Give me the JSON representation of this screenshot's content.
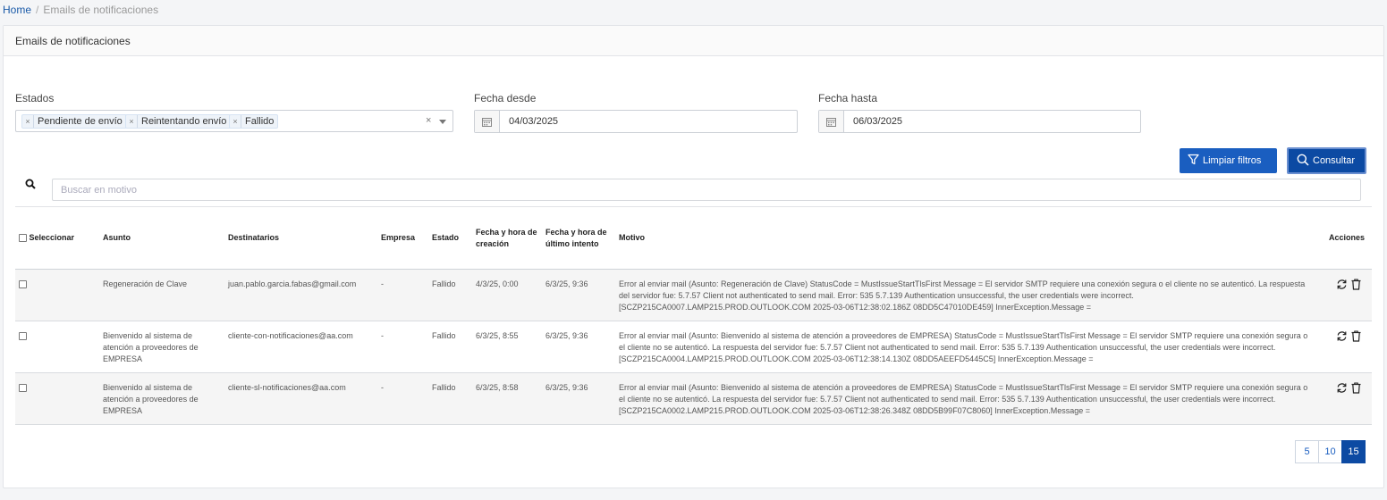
{
  "breadcrumb": {
    "home": "Home",
    "separator": "/",
    "current": "Emails de notificaciones"
  },
  "card": {
    "title": "Emails de notificaciones"
  },
  "filters": {
    "estados": {
      "label": "Estados",
      "tags": [
        "Pendiente de envío",
        "Reintentando envío",
        "Fallido"
      ],
      "remove": "×",
      "clear": "×"
    },
    "fecha_desde": {
      "label": "Fecha desde",
      "value": "04/03/2025",
      "icon": "calendar-icon"
    },
    "fecha_hasta": {
      "label": "Fecha hasta",
      "value": "06/03/2025",
      "icon": "calendar-icon"
    }
  },
  "buttons": {
    "clear": "Limpiar filtros",
    "search": "Consultar"
  },
  "search": {
    "placeholder": "Buscar en motivo"
  },
  "table": {
    "headers": {
      "select": "Seleccionar",
      "asunto": "Asunto",
      "destinatarios": "Destinatarios",
      "empresa": "Empresa",
      "estado": "Estado",
      "fecha_creacion": "Fecha y hora de creación",
      "fecha_ultimo": "Fecha y hora de último intento",
      "motivo": "Motivo",
      "acciones": "Acciones"
    },
    "rows": [
      {
        "asunto": "Regeneración de Clave",
        "destinatarios": "juan.pablo.garcia.fabas@gmail.com",
        "empresa": "-",
        "estado": "Fallido",
        "fecha_creacion": "4/3/25, 0:00",
        "fecha_ultimo": "6/3/25, 9:36",
        "motivo": "Error al enviar mail (Asunto: Regeneración de Clave) StatusCode = MustIssueStartTlsFirst Message = El servidor SMTP requiere una conexión segura o el cliente no se autenticó. La respuesta del servidor fue: 5.7.57 Client not authenticated to send mail. Error: 535 5.7.139 Authentication unsuccessful, the user credentials were incorrect. [SCZP215CA0007.LAMP215.PROD.OUTLOOK.COM 2025-03-06T12:38:02.186Z 08DD5C47010DE459] InnerException.Message ="
      },
      {
        "asunto": "Bienvenido al sistema de atención a proveedores de EMPRESA",
        "destinatarios": "cliente-con-notificaciones@aa.com",
        "empresa": "-",
        "estado": "Fallido",
        "fecha_creacion": "6/3/25, 8:55",
        "fecha_ultimo": "6/3/25, 9:36",
        "motivo": "Error al enviar mail (Asunto: Bienvenido al sistema de atención a proveedores de EMPRESA) StatusCode = MustIssueStartTlsFirst Message = El servidor SMTP requiere una conexión segura o el cliente no se autenticó. La respuesta del servidor fue: 5.7.57 Client not authenticated to send mail. Error: 535 5.7.139 Authentication unsuccessful, the user credentials were incorrect. [SCZP215CA0004.LAMP215.PROD.OUTLOOK.COM 2025-03-06T12:38:14.130Z 08DD5AEEFD5445C5] InnerException.Message ="
      },
      {
        "asunto": "Bienvenido al sistema de atención a proveedores de EMPRESA",
        "destinatarios": "cliente-sl-notificaciones@aa.com",
        "empresa": "-",
        "estado": "Fallido",
        "fecha_creacion": "6/3/25, 8:58",
        "fecha_ultimo": "6/3/25, 9:36",
        "motivo": "Error al enviar mail (Asunto: Bienvenido al sistema de atención a proveedores de EMPRESA) StatusCode = MustIssueStartTlsFirst Message = El servidor SMTP requiere una conexión segura o el cliente no se autenticó. La respuesta del servidor fue: 5.7.57 Client not authenticated to send mail. Error: 535 5.7.139 Authentication unsuccessful, the user credentials were incorrect. [SCZP215CA0002.LAMP215.PROD.OUTLOOK.COM 2025-03-06T12:38:26.348Z 08DD5B99F07C8060] InnerException.Message ="
      }
    ]
  },
  "pagination": {
    "sizes": [
      "5",
      "10",
      "15"
    ],
    "active": "15"
  },
  "colors": {
    "primary": "#1a5ec0",
    "primary_dark": "#0c4aa3",
    "link": "#1a5aa8"
  }
}
